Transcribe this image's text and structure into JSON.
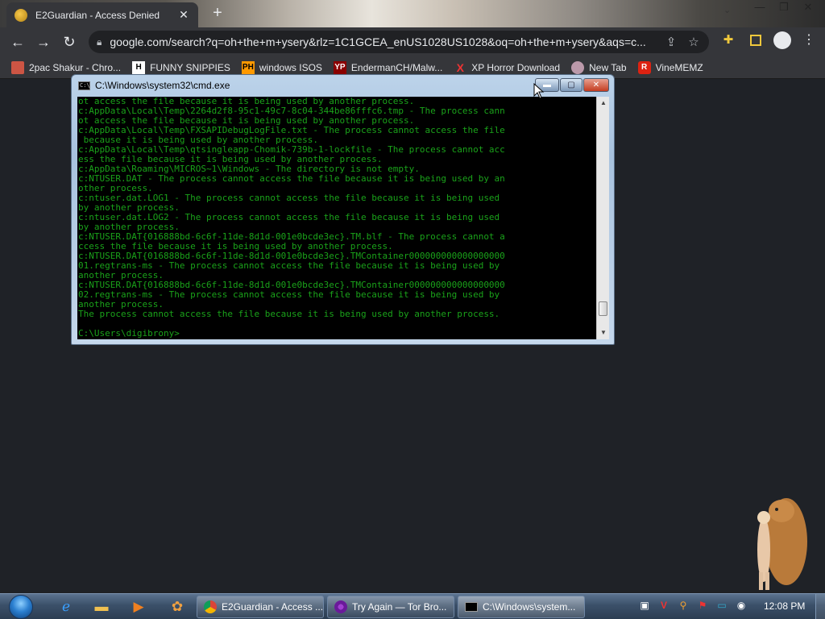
{
  "browser": {
    "tab": {
      "title": "E2Guardian - Access Denied",
      "close_glyph": "✕"
    },
    "new_tab_glyph": "+",
    "window_controls": {
      "minimize": "—",
      "maximize": "❐",
      "close": "✕",
      "tab_search": "⌄"
    },
    "nav": {
      "back": "←",
      "forward": "→",
      "reload": "↻"
    },
    "url": "google.com/search?q=oh+the+m+ysery&rlz=1C1GCEA_enUS1028US1028&oq=oh+the+m+ysery&aqs=c...",
    "omnibox_icons": [
      "share-icon",
      "star-icon"
    ],
    "bookmarks": [
      {
        "label": "2pac Shakur - Chro...",
        "icon": ""
      },
      {
        "label": "FUNNY SNIPPIES",
        "icon": "H"
      },
      {
        "label": "windows ISOS",
        "icon": "PH"
      },
      {
        "label": "EndermanCH/Malw...",
        "icon": "YP"
      },
      {
        "label": "XP Horror Download",
        "icon": "X"
      },
      {
        "label": "New Tab",
        "icon": ""
      },
      {
        "label": "VineMEMZ",
        "icon": "R"
      }
    ]
  },
  "cmd": {
    "title": "C:\\Windows\\system32\\cmd.exe",
    "lines": [
      "ot access the file because it is being used by another process.",
      "c:AppData\\Local\\Temp\\2264d2f8-95c1-49c7-8c04-344be86fffc6.tmp - The process cann",
      "ot access the file because it is being used by another process.",
      "c:AppData\\Local\\Temp\\FXSAPIDebugLogFile.txt - The process cannot access the file",
      " because it is being used by another process.",
      "c:AppData\\Local\\Temp\\qtsingleapp-Chomik-739b-1-lockfile - The process cannot acc",
      "ess the file because it is being used by another process.",
      "c:AppData\\Roaming\\MICROS~1\\Windows - The directory is not empty.",
      "c:NTUSER.DAT - The process cannot access the file because it is being used by an",
      "other process.",
      "c:ntuser.dat.LOG1 - The process cannot access the file because it is being used",
      "by another process.",
      "c:ntuser.dat.LOG2 - The process cannot access the file because it is being used",
      "by another process.",
      "c:NTUSER.DAT{016888bd-6c6f-11de-8d1d-001e0bcde3ec}.TM.blf - The process cannot a",
      "ccess the file because it is being used by another process.",
      "c:NTUSER.DAT{016888bd-6c6f-11de-8d1d-001e0bcde3ec}.TMContainer000000000000000000",
      "01.regtrans-ms - The process cannot access the file because it is being used by",
      "another process.",
      "c:NTUSER.DAT{016888bd-6c6f-11de-8d1d-001e0bcde3ec}.TMContainer000000000000000000",
      "02.regtrans-ms - The process cannot access the file because it is being used by",
      "another process.",
      "The process cannot access the file because it is being used by another process.",
      "",
      "C:\\Users\\digibrony>"
    ],
    "buttons": {
      "minimize": "▬",
      "maximize": "▢",
      "close": "✕"
    }
  },
  "taskbar": {
    "tasks": [
      {
        "label": "E2Guardian - Access ...",
        "icon": "chrome-icon"
      },
      {
        "label": "Try Again — Tor Bro...",
        "icon": "tor-icon"
      },
      {
        "label": "C:\\Windows\\system...",
        "icon": "cmd-icon"
      }
    ],
    "clock": "12:08 PM",
    "tray_icons": [
      "monitor-icon",
      "v-icon",
      "search-icon",
      "flag-icon",
      "display-icon",
      "speaker-icon"
    ]
  },
  "colors": {
    "desktop_bg": "#1f2227",
    "console_text": "#1aa21a",
    "chrome_toolbar": "#35363a"
  }
}
